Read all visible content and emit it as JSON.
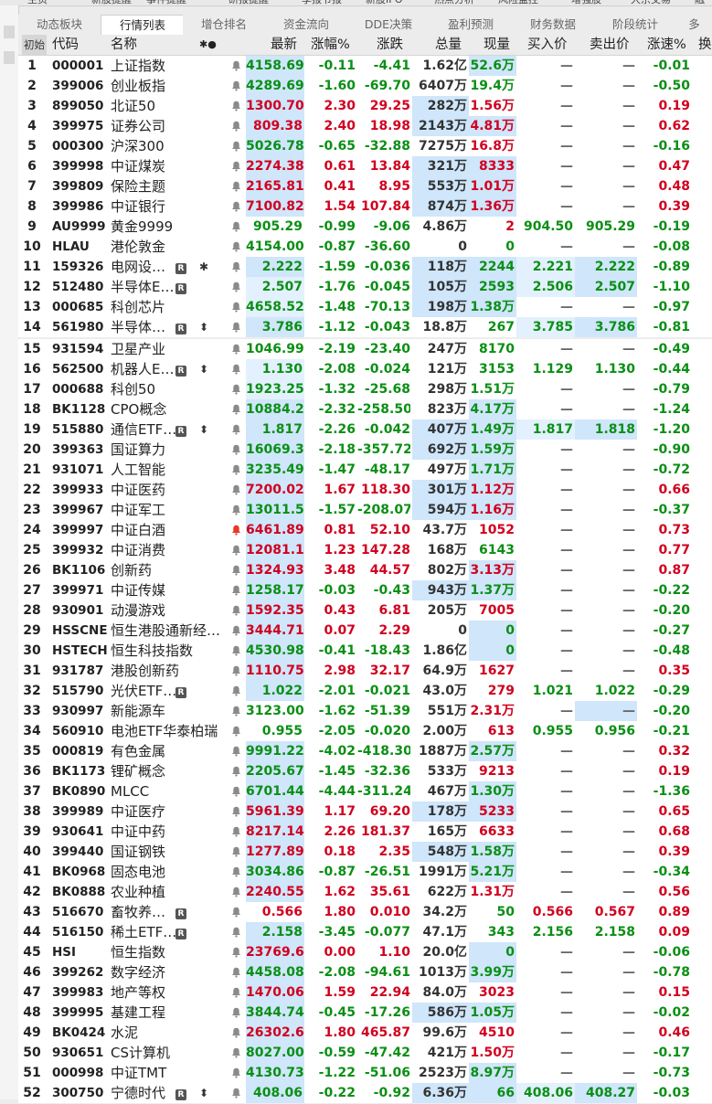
{
  "top_strip": [
    "主页",
    "新股提醒",
    "事件提醒",
    "研报提醒",
    "季报节报",
    "新股IPO",
    "热点分析",
    "风险监控",
    "增强股",
    "大宗交易",
    "融资"
  ],
  "tabs": [
    {
      "label": "动态板块",
      "active": false
    },
    {
      "label": "行情列表",
      "active": true
    },
    {
      "label": "增仓排名",
      "active": false
    },
    {
      "label": "资金流向",
      "active": false
    },
    {
      "label": "DDE决策",
      "active": false
    },
    {
      "label": "盈利预测",
      "active": false
    },
    {
      "label": "财务数据",
      "active": false
    },
    {
      "label": "阶段统计",
      "active": false
    },
    {
      "label": "多",
      "active": false
    }
  ],
  "header": {
    "init": "初始",
    "code": "代码",
    "name": "名称",
    "marks": "✱●",
    "price": "最新",
    "pct": "涨幅%",
    "chg": "涨跌",
    "vol": "总量",
    "cur": "现量",
    "bid": "买入价",
    "ask": "卖出价",
    "spd": "涨速%",
    "extra": "换"
  },
  "icons": {
    "bell": "bell-icon",
    "r_badge": "R",
    "star": "✱",
    "arrow": "⬍",
    "bell_glyph": "🔔"
  },
  "rows": [
    {
      "i": "1",
      "code": "000001",
      "name": "上证指数",
      "price": "4158.69",
      "pct": "-0.11",
      "chg": "-4.41",
      "vol": "1.62亿",
      "cur": "52.6万",
      "bid": "—",
      "ask": "—",
      "spd": "-0.01",
      "d": "dn",
      "vd": "dn",
      "sd": "dn"
    },
    {
      "i": "2",
      "code": "399006",
      "name": "创业板指",
      "price": "4289.69",
      "pct": "-1.60",
      "chg": "-69.70",
      "vol": "6407万",
      "cur": "19.4万",
      "bid": "—",
      "ask": "—",
      "spd": "-0.50",
      "d": "dn",
      "vd": "dn",
      "sd": "dn"
    },
    {
      "i": "3",
      "code": "899050",
      "name": "北证50",
      "price": "1300.70",
      "pct": "2.30",
      "chg": "29.25",
      "vol": "282万",
      "cur": "1.56万",
      "bid": "—",
      "ask": "—",
      "spd": "0.19",
      "d": "up",
      "vd": "up",
      "sd": "up"
    },
    {
      "i": "4",
      "code": "399975",
      "name": "证券公司",
      "price": "809.38",
      "pct": "2.40",
      "chg": "18.98",
      "vol": "2143万",
      "cur": "4.81万",
      "bid": "—",
      "ask": "—",
      "spd": "0.62",
      "d": "up",
      "vd": "up",
      "sd": "up"
    },
    {
      "i": "5",
      "code": "000300",
      "name": "沪深300",
      "price": "5026.78",
      "pct": "-0.65",
      "chg": "-32.88",
      "vol": "7275万",
      "cur": "16.8万",
      "bid": "—",
      "ask": "—",
      "spd": "-0.16",
      "d": "dn",
      "vd": "up",
      "sd": "dn"
    },
    {
      "i": "6",
      "code": "399998",
      "name": "中证煤炭",
      "price": "2274.38",
      "pct": "0.61",
      "chg": "13.84",
      "vol": "321万",
      "cur": "8333",
      "bid": "—",
      "ask": "—",
      "spd": "0.47",
      "d": "up",
      "vd": "up",
      "sd": "up"
    },
    {
      "i": "7",
      "code": "399809",
      "name": "保险主题",
      "price": "2165.81",
      "pct": "0.41",
      "chg": "8.95",
      "vol": "553万",
      "cur": "1.01万",
      "bid": "—",
      "ask": "—",
      "spd": "0.48",
      "d": "up",
      "vd": "up",
      "sd": "up"
    },
    {
      "i": "8",
      "code": "399986",
      "name": "中证银行",
      "price": "7100.82",
      "pct": "1.54",
      "chg": "107.84",
      "vol": "874万",
      "cur": "1.36万",
      "bid": "—",
      "ask": "—",
      "spd": "0.39",
      "d": "up",
      "vd": "up",
      "sd": "up"
    },
    {
      "i": "9",
      "code": "AU9999",
      "name": "黄金9999",
      "price": "905.29",
      "pct": "-0.99",
      "chg": "-9.06",
      "vol": "4.86万",
      "cur": "2",
      "bid": "904.50",
      "ask": "905.29",
      "spd": "-0.19",
      "d": "dn",
      "vd": "up",
      "sd": "dn"
    },
    {
      "i": "10",
      "code": "HLAU",
      "name": "港伦敦金",
      "price": "4154.00",
      "pct": "-0.87",
      "chg": "-36.60",
      "vol": "0",
      "cur": "0",
      "bid": "—",
      "ask": "—",
      "spd": "-0.08",
      "d": "dn",
      "vd": "dn",
      "sd": "dn"
    },
    {
      "i": "11",
      "code": "159326",
      "name": "电网设…",
      "price": "2.222",
      "pct": "-1.59",
      "chg": "-0.036",
      "vol": "118万",
      "cur": "2244",
      "bid": "2.221",
      "ask": "2.222",
      "spd": "-0.89",
      "d": "dn",
      "vd": "dn",
      "sd": "dn",
      "r": true,
      "star": true
    },
    {
      "i": "12",
      "code": "512480",
      "name": "半导体E…",
      "price": "2.507",
      "pct": "-1.76",
      "chg": "-0.045",
      "vol": "105万",
      "cur": "2593",
      "bid": "2.506",
      "ask": "2.507",
      "spd": "-1.10",
      "d": "dn",
      "vd": "dn",
      "sd": "dn",
      "r": true
    },
    {
      "i": "13",
      "code": "000685",
      "name": "科创芯片",
      "price": "4658.52",
      "pct": "-1.48",
      "chg": "-70.13",
      "vol": "198万",
      "cur": "1.38万",
      "bid": "—",
      "ask": "—",
      "spd": "-0.97",
      "d": "dn",
      "vd": "dn",
      "sd": "dn"
    },
    {
      "i": "14",
      "code": "561980",
      "name": "半导体…",
      "price": "3.786",
      "pct": "-1.12",
      "chg": "-0.043",
      "vol": "18.8万",
      "cur": "267",
      "bid": "3.785",
      "ask": "3.786",
      "spd": "-0.81",
      "d": "dn",
      "vd": "dn",
      "sd": "dn",
      "r": true,
      "arrow": true
    },
    {
      "i": "15",
      "code": "931594",
      "name": "卫星产业",
      "price": "1046.99",
      "pct": "-2.19",
      "chg": "-23.40",
      "vol": "247万",
      "cur": "8170",
      "bid": "—",
      "ask": "—",
      "spd": "-0.49",
      "d": "dn",
      "vd": "dn",
      "sd": "dn"
    },
    {
      "i": "16",
      "code": "562500",
      "name": "机器人E…",
      "price": "1.130",
      "pct": "-2.08",
      "chg": "-0.024",
      "vol": "121万",
      "cur": "3153",
      "bid": "1.129",
      "ask": "1.130",
      "spd": "-0.44",
      "d": "dn",
      "vd": "dn",
      "sd": "dn",
      "r": true,
      "arrow": true
    },
    {
      "i": "17",
      "code": "000688",
      "name": "科创50",
      "price": "1923.25",
      "pct": "-1.32",
      "chg": "-25.68",
      "vol": "298万",
      "cur": "1.51万",
      "bid": "—",
      "ask": "—",
      "spd": "-0.79",
      "d": "dn",
      "vd": "dn",
      "sd": "dn"
    },
    {
      "i": "18",
      "code": "BK1128",
      "name": "CPO概念",
      "price": "10884.26",
      "pct": "-2.32",
      "chg": "-258.50",
      "vol": "823万",
      "cur": "4.17万",
      "bid": "—",
      "ask": "—",
      "spd": "-1.24",
      "d": "dn",
      "vd": "dn",
      "sd": "dn"
    },
    {
      "i": "19",
      "code": "515880",
      "name": "通信ETF…",
      "price": "1.817",
      "pct": "-2.26",
      "chg": "-0.042",
      "vol": "407万",
      "cur": "1.49万",
      "bid": "1.817",
      "ask": "1.818",
      "spd": "-1.20",
      "d": "dn",
      "vd": "dn",
      "sd": "dn",
      "r": true,
      "arrow": true
    },
    {
      "i": "20",
      "code": "399363",
      "name": "国证算力",
      "price": "16069.32",
      "pct": "-2.18",
      "chg": "-357.72",
      "vol": "692万",
      "cur": "1.59万",
      "bid": "—",
      "ask": "—",
      "spd": "-0.90",
      "d": "dn",
      "vd": "dn",
      "sd": "dn"
    },
    {
      "i": "21",
      "code": "931071",
      "name": "人工智能",
      "price": "3235.49",
      "pct": "-1.47",
      "chg": "-48.17",
      "vol": "497万",
      "cur": "1.71万",
      "bid": "—",
      "ask": "—",
      "spd": "-0.72",
      "d": "dn",
      "vd": "dn",
      "sd": "dn"
    },
    {
      "i": "22",
      "code": "399933",
      "name": "中证医药",
      "price": "7200.02",
      "pct": "1.67",
      "chg": "118.30",
      "vol": "301万",
      "cur": "1.12万",
      "bid": "—",
      "ask": "—",
      "spd": "0.66",
      "d": "up",
      "vd": "up",
      "sd": "up"
    },
    {
      "i": "23",
      "code": "399967",
      "name": "中证军工",
      "price": "13011.51",
      "pct": "-1.57",
      "chg": "-208.07",
      "vol": "594万",
      "cur": "1.16万",
      "bid": "—",
      "ask": "—",
      "spd": "-0.37",
      "d": "dn",
      "vd": "up",
      "sd": "dn"
    },
    {
      "i": "24",
      "code": "399997",
      "name": "中证白酒",
      "price": "6461.89",
      "pct": "0.81",
      "chg": "52.10",
      "vol": "43.7万",
      "cur": "1052",
      "bid": "—",
      "ask": "—",
      "spd": "0.73",
      "d": "up",
      "vd": "up",
      "sd": "up",
      "hotbell": true
    },
    {
      "i": "25",
      "code": "399932",
      "name": "中证消费",
      "price": "12081.16",
      "pct": "1.23",
      "chg": "147.28",
      "vol": "168万",
      "cur": "6143",
      "bid": "—",
      "ask": "—",
      "spd": "0.77",
      "d": "up",
      "vd": "dn",
      "sd": "up"
    },
    {
      "i": "26",
      "code": "BK1106",
      "name": "创新药",
      "price": "1324.93",
      "pct": "3.48",
      "chg": "44.57",
      "vol": "802万",
      "cur": "3.13万",
      "bid": "—",
      "ask": "—",
      "spd": "0.87",
      "d": "up",
      "vd": "up",
      "sd": "up"
    },
    {
      "i": "27",
      "code": "399971",
      "name": "中证传媒",
      "price": "1258.17",
      "pct": "-0.03",
      "chg": "-0.43",
      "vol": "943万",
      "cur": "1.37万",
      "bid": "—",
      "ask": "—",
      "spd": "-0.22",
      "d": "dn",
      "vd": "dn",
      "sd": "dn"
    },
    {
      "i": "28",
      "code": "930901",
      "name": "动漫游戏",
      "price": "1592.35",
      "pct": "0.43",
      "chg": "6.81",
      "vol": "205万",
      "cur": "7005",
      "bid": "—",
      "ask": "—",
      "spd": "-0.20",
      "d": "up",
      "vd": "up",
      "sd": "dn"
    },
    {
      "i": "29",
      "code": "HSSCNE",
      "name": "恒生港股通新经…",
      "price": "3444.71",
      "pct": "0.07",
      "chg": "2.29",
      "vol": "0",
      "cur": "0",
      "bid": "—",
      "ask": "—",
      "spd": "-0.27",
      "d": "up",
      "vd": "dn",
      "sd": "dn"
    },
    {
      "i": "30",
      "code": "HSTECH",
      "name": "恒生科技指数",
      "price": "4530.98",
      "pct": "-0.41",
      "chg": "-18.43",
      "vol": "1.86亿",
      "cur": "0",
      "bid": "—",
      "ask": "—",
      "spd": "-0.48",
      "d": "dn",
      "vd": "dn",
      "sd": "dn"
    },
    {
      "i": "31",
      "code": "931787",
      "name": "港股创新药",
      "price": "1110.75",
      "pct": "2.98",
      "chg": "32.17",
      "vol": "64.9万",
      "cur": "1627",
      "bid": "—",
      "ask": "—",
      "spd": "0.35",
      "d": "up",
      "vd": "up",
      "sd": "up"
    },
    {
      "i": "32",
      "code": "515790",
      "name": "光伏ETF…",
      "price": "1.022",
      "pct": "-2.01",
      "chg": "-0.021",
      "vol": "43.0万",
      "cur": "279",
      "bid": "1.021",
      "ask": "1.022",
      "spd": "-0.29",
      "d": "dn",
      "vd": "up",
      "sd": "dn",
      "r": true
    },
    {
      "i": "33",
      "code": "930997",
      "name": "新能源车",
      "price": "3123.00",
      "pct": "-1.62",
      "chg": "-51.39",
      "vol": "551万",
      "cur": "2.31万",
      "bid": "—",
      "ask": "—",
      "spd": "-0.20",
      "d": "dn",
      "vd": "up",
      "sd": "dn"
    },
    {
      "i": "34",
      "code": "560910",
      "name": "电池ETF华泰柏瑞",
      "price": "0.955",
      "pct": "-2.05",
      "chg": "-0.020",
      "vol": "2.00万",
      "cur": "613",
      "bid": "0.955",
      "ask": "0.956",
      "spd": "-0.21",
      "d": "dn",
      "vd": "up",
      "sd": "dn"
    },
    {
      "i": "35",
      "code": "000819",
      "name": "有色金属",
      "price": "9991.22",
      "pct": "-4.02",
      "chg": "-418.30",
      "vol": "1887万",
      "cur": "2.57万",
      "bid": "—",
      "ask": "—",
      "spd": "0.32",
      "d": "dn",
      "vd": "dn",
      "sd": "up"
    },
    {
      "i": "36",
      "code": "BK1173",
      "name": "锂矿概念",
      "price": "2205.67",
      "pct": "-1.45",
      "chg": "-32.36",
      "vol": "533万",
      "cur": "9213",
      "bid": "—",
      "ask": "—",
      "spd": "0.19",
      "d": "dn",
      "vd": "up",
      "sd": "up"
    },
    {
      "i": "37",
      "code": "BK0890",
      "name": "MLCC",
      "price": "6701.44",
      "pct": "-4.44",
      "chg": "-311.24",
      "vol": "467万",
      "cur": "1.30万",
      "bid": "—",
      "ask": "—",
      "spd": "-1.36",
      "d": "dn",
      "vd": "dn",
      "sd": "dn"
    },
    {
      "i": "38",
      "code": "399989",
      "name": "中证医疗",
      "price": "5961.39",
      "pct": "1.17",
      "chg": "69.20",
      "vol": "178万",
      "cur": "5233",
      "bid": "—",
      "ask": "—",
      "spd": "0.65",
      "d": "up",
      "vd": "up",
      "sd": "up"
    },
    {
      "i": "39",
      "code": "930641",
      "name": "中证中药",
      "price": "8217.14",
      "pct": "2.26",
      "chg": "181.37",
      "vol": "165万",
      "cur": "6633",
      "bid": "—",
      "ask": "—",
      "spd": "0.68",
      "d": "up",
      "vd": "up",
      "sd": "up"
    },
    {
      "i": "40",
      "code": "399440",
      "name": "国证钢铁",
      "price": "1277.89",
      "pct": "0.18",
      "chg": "2.35",
      "vol": "548万",
      "cur": "1.58万",
      "bid": "—",
      "ask": "—",
      "spd": "0.39",
      "d": "up",
      "vd": "dn",
      "sd": "up"
    },
    {
      "i": "41",
      "code": "BK0968",
      "name": "固态电池",
      "price": "3034.86",
      "pct": "-0.87",
      "chg": "-26.51",
      "vol": "1991万",
      "cur": "5.21万",
      "bid": "—",
      "ask": "—",
      "spd": "-0.34",
      "d": "dn",
      "vd": "dn",
      "sd": "dn"
    },
    {
      "i": "42",
      "code": "BK0888",
      "name": "农业种植",
      "price": "2240.55",
      "pct": "1.62",
      "chg": "35.61",
      "vol": "622万",
      "cur": "1.31万",
      "bid": "—",
      "ask": "—",
      "spd": "0.56",
      "d": "up",
      "vd": "up",
      "sd": "up"
    },
    {
      "i": "43",
      "code": "516670",
      "name": "畜牧养…",
      "price": "0.566",
      "pct": "1.80",
      "chg": "0.010",
      "vol": "34.2万",
      "cur": "50",
      "bid": "0.566",
      "ask": "0.567",
      "spd": "0.89",
      "d": "up",
      "vd": "dn",
      "sd": "up",
      "r": true
    },
    {
      "i": "44",
      "code": "516150",
      "name": "稀土ETF…",
      "price": "2.158",
      "pct": "-3.45",
      "chg": "-0.077",
      "vol": "47.1万",
      "cur": "343",
      "bid": "2.156",
      "ask": "2.158",
      "spd": "0.09",
      "d": "dn",
      "vd": "dn",
      "sd": "up",
      "r": true
    },
    {
      "i": "45",
      "code": "HSI",
      "name": "恒生指数",
      "price": "23769.62",
      "pct": "0.00",
      "chg": "1.10",
      "vol": "20.0亿",
      "cur": "0",
      "bid": "—",
      "ask": "—",
      "spd": "-0.06",
      "d": "up",
      "vd": "dn",
      "sd": "dn"
    },
    {
      "i": "46",
      "code": "399262",
      "name": "数字经济",
      "price": "4458.08",
      "pct": "-2.08",
      "chg": "-94.61",
      "vol": "1013万",
      "cur": "3.99万",
      "bid": "—",
      "ask": "—",
      "spd": "-0.78",
      "d": "dn",
      "vd": "dn",
      "sd": "dn"
    },
    {
      "i": "47",
      "code": "399983",
      "name": "地产等权",
      "price": "1470.06",
      "pct": "1.59",
      "chg": "22.94",
      "vol": "84.0万",
      "cur": "3023",
      "bid": "—",
      "ask": "—",
      "spd": "0.15",
      "d": "up",
      "vd": "up",
      "sd": "up"
    },
    {
      "i": "48",
      "code": "399995",
      "name": "基建工程",
      "price": "3844.74",
      "pct": "-0.45",
      "chg": "-17.26",
      "vol": "586万",
      "cur": "1.05万",
      "bid": "—",
      "ask": "—",
      "spd": "-0.02",
      "d": "dn",
      "vd": "dn",
      "sd": "dn"
    },
    {
      "i": "49",
      "code": "BK0424",
      "name": "水泥",
      "price": "26302.67",
      "pct": "1.80",
      "chg": "465.87",
      "vol": "99.6万",
      "cur": "4510",
      "bid": "—",
      "ask": "—",
      "spd": "0.46",
      "d": "up",
      "vd": "up",
      "sd": "up"
    },
    {
      "i": "50",
      "code": "930651",
      "name": "CS计算机",
      "price": "8027.00",
      "pct": "-0.59",
      "chg": "-47.42",
      "vol": "421万",
      "cur": "1.50万",
      "bid": "—",
      "ask": "—",
      "spd": "-0.17",
      "d": "dn",
      "vd": "up",
      "sd": "dn"
    },
    {
      "i": "51",
      "code": "000998",
      "name": "中证TMT",
      "price": "4130.73",
      "pct": "-1.22",
      "chg": "-51.06",
      "vol": "2523万",
      "cur": "8.97万",
      "bid": "—",
      "ask": "—",
      "spd": "-0.73",
      "d": "dn",
      "vd": "dn",
      "sd": "dn"
    },
    {
      "i": "52",
      "code": "300750",
      "name": "宁德时代",
      "price": "408.06",
      "pct": "-0.22",
      "chg": "-0.92",
      "vol": "6.36万",
      "cur": "66",
      "bid": "408.06",
      "ask": "408.27",
      "spd": "-0.03",
      "d": "dn",
      "vd": "dn",
      "sd": "dn",
      "r": true,
      "arrow": true
    }
  ],
  "colors": {
    "up": "#d1001f",
    "down": "#0a8f14",
    "highlight": "#cfe6fb",
    "separator": "#e07a2a"
  }
}
